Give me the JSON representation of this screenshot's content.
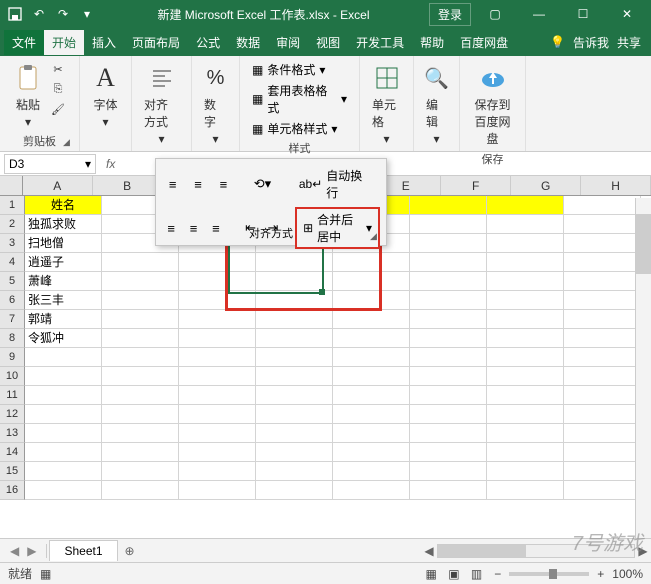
{
  "title": "新建 Microsoft Excel 工作表.xlsx - Excel",
  "login": "登录",
  "ribtabs": {
    "file": "文件",
    "home": "开始",
    "insert": "插入",
    "layout": "页面布局",
    "formula": "公式",
    "data": "数据",
    "review": "审阅",
    "view": "视图",
    "dev": "开发工具",
    "help": "帮助",
    "baidu": "百度网盘",
    "tell": "告诉我",
    "share": "共享"
  },
  "groups": {
    "clipboard": "剪贴板",
    "font": "字体",
    "align": "对齐方式",
    "number": "数字",
    "styles": "样式",
    "cells": "单元格",
    "editing": "编辑",
    "save": "保存"
  },
  "btns": {
    "paste": "粘贴",
    "alignment": "对齐方式",
    "numfmt": "数字",
    "cond": "条件格式",
    "tablefmt": "套用表格格式",
    "cellstyle": "单元格样式",
    "cells": "单元格",
    "editing": "编辑",
    "savebaidu": "保存到\n百度网盘",
    "wrap": "自动换行",
    "merge": "合并后居中"
  },
  "namebox": "D3",
  "cols": [
    "A",
    "B",
    "E",
    "F",
    "G",
    "H"
  ],
  "rows": [
    "1",
    "2",
    "3",
    "4",
    "5",
    "6",
    "7",
    "8",
    "9",
    "10",
    "11",
    "12",
    "13",
    "14",
    "15",
    "16"
  ],
  "cells": {
    "A1": "姓名",
    "A2": "独孤求败",
    "A3": "扫地僧",
    "A4": "逍遥子",
    "A5": "萧峰",
    "A6": "张三丰",
    "A7": "郭靖",
    "A8": "令狐冲"
  },
  "sheet": "Sheet1",
  "status": {
    "ready": "就绪",
    "zoom": "100%"
  },
  "watermark": "7号游戏"
}
